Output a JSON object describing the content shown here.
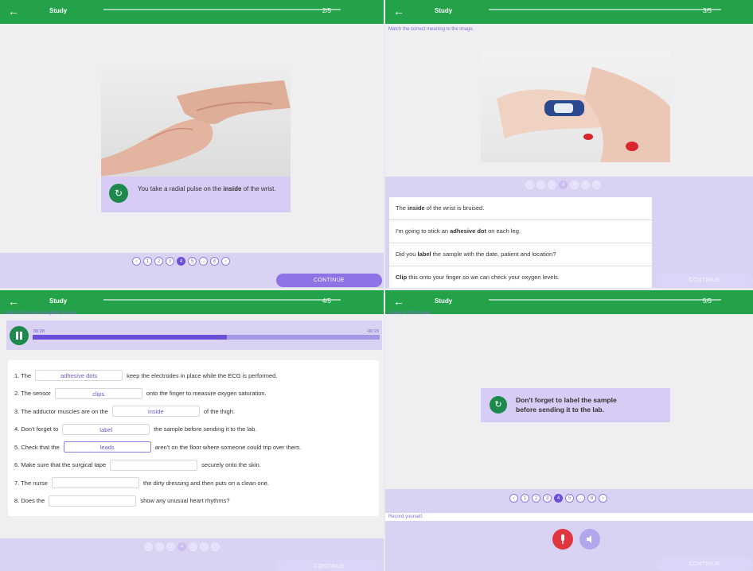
{
  "common": {
    "back_icon": "arrow-left-icon",
    "title": "Study",
    "continue": "CONTINUE"
  },
  "colors": {
    "topbar": "#23a24a",
    "accent": "#6b4fdb",
    "lavender": "#d9d2f3",
    "record": "#e0363f"
  },
  "p1": {
    "counter": "2/5",
    "caption_pre": "You take a radial pulse on the ",
    "caption_bold": "inside",
    "caption_post": " of the wrist.",
    "dots": [
      "‹",
      "1",
      "2",
      "3",
      "4",
      "5",
      "…",
      "8",
      "›"
    ],
    "active_dot": 4
  },
  "p2": {
    "counter": "3/5",
    "instruction": "Match the correct meaning to the image.",
    "dots": [
      "1",
      "2",
      "3",
      "4",
      "5",
      "6",
      "7"
    ],
    "active_dot": 3,
    "options": [
      {
        "pre": "The ",
        "bold": "inside",
        "post": " of the wrist is bruised."
      },
      {
        "pre": "I'm going to stick an ",
        "bold": "adhesive dot",
        "post": " on each leg."
      },
      {
        "pre": "Did you ",
        "bold": "label",
        "post": " the sample with the date, patient and location?"
      },
      {
        "pre": "",
        "bold": "Clip",
        "post": " this onto your finger so we can check your oxygen levels."
      }
    ]
  },
  "p3": {
    "counter": "4/5",
    "instruction": "Listen to this and complete the text.",
    "time_elapsed": "00:28",
    "time_remaining": "-00:23",
    "progress": 0.56,
    "dots": [
      "1",
      "2",
      "3",
      "4",
      "5",
      "6",
      "7"
    ],
    "active_dot": 3,
    "lines": [
      {
        "pre": "1. The",
        "answer": "adhesive dots",
        "post": "keep the electrodes in place while the ECG is performed."
      },
      {
        "pre": "2. The sensor",
        "answer": "clips",
        "post": "onto the finger to measure oxygen saturation."
      },
      {
        "pre": "3. The adductor muscles are on the",
        "answer": "inside",
        "post": "of the thigh."
      },
      {
        "pre": "4. Don't forget to",
        "answer": "label",
        "post": "the sample before sending it to the lab."
      },
      {
        "pre": "5. Check that the",
        "answer": "leads",
        "post": "aren't on the floor where someone could trip over them."
      },
      {
        "pre": "6. Make sure that the surgical tape",
        "answer": "",
        "post": "securely onto the skin."
      },
      {
        "pre": "7. The nurse",
        "answer": "",
        "post": "the dirty dressing and then puts on a clean one."
      },
      {
        "pre": "8. Does the",
        "answer": "",
        "post": "show any unusual heart rhythms?"
      }
    ]
  },
  "p4": {
    "counter": "5/5",
    "instruction": "Listen to this model.",
    "model_line1": "Don't forget to label the sample",
    "model_line2": "before sending it to the lab.",
    "dots": [
      "‹",
      "1",
      "2",
      "3",
      "4",
      "5",
      "…",
      "8",
      "›"
    ],
    "active_dot": 4,
    "record_label": "Record yourself."
  }
}
